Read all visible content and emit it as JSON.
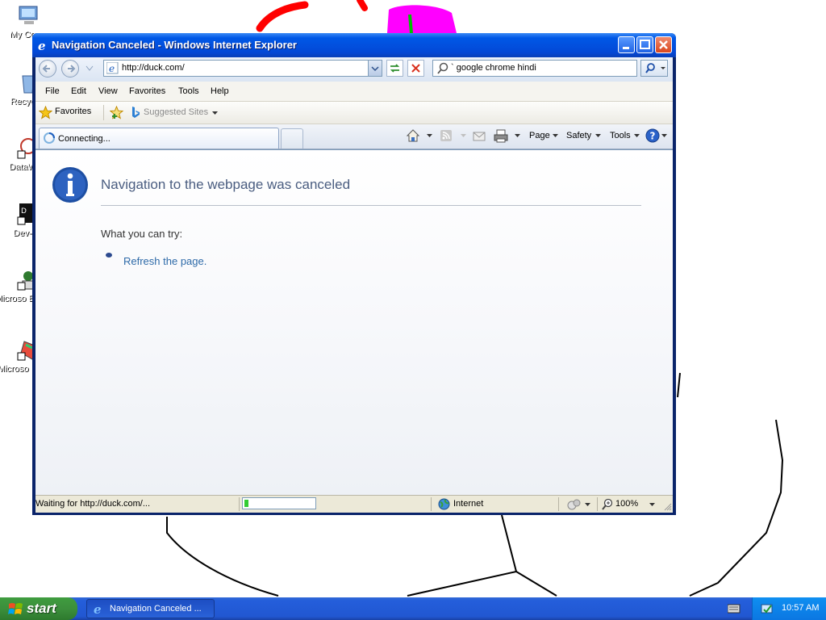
{
  "desktop": {
    "icons": [
      {
        "label": "My Co",
        "icon": "my-computer-icon"
      },
      {
        "label": "Recyc",
        "icon": "recycle-bin-icon"
      },
      {
        "label": "DataW",
        "icon": "datawarehouse-shortcut-icon"
      },
      {
        "label": "Dev-",
        "icon": "dev-cpp-shortcut-icon"
      },
      {
        "label": "Microso Basic",
        "icon": "vb-shortcut-icon"
      },
      {
        "label": "Microso C++",
        "icon": "vcpp-shortcut-icon"
      }
    ]
  },
  "window": {
    "title": "Navigation Canceled - Windows Internet Explorer",
    "address": "http://duck.com/",
    "search_query": "` google chrome hindi",
    "menu": [
      "File",
      "Edit",
      "View",
      "Favorites",
      "Tools",
      "Help"
    ],
    "favorites_label": "Favorites",
    "suggested_sites": "Suggested Sites",
    "tab_label": "Connecting...",
    "commands": {
      "page": "Page",
      "safety": "Safety",
      "tools": "Tools"
    }
  },
  "content": {
    "title": "Navigation to the webpage was canceled",
    "try_text": "What you can try:",
    "refresh_link": "Refresh the page."
  },
  "status": {
    "text": "Waiting for http://duck.com/...",
    "progress": 0.06,
    "zone": "Internet",
    "zoom": "100%"
  },
  "taskbar": {
    "start": "start",
    "task_label": "Navigation Canceled ...",
    "clock": "10:57 AM"
  },
  "colors": {
    "title_bar": "#0058e6",
    "start_green": "#3c8f3c",
    "link": "#2e6aa8",
    "heading": "#4a5d80"
  }
}
